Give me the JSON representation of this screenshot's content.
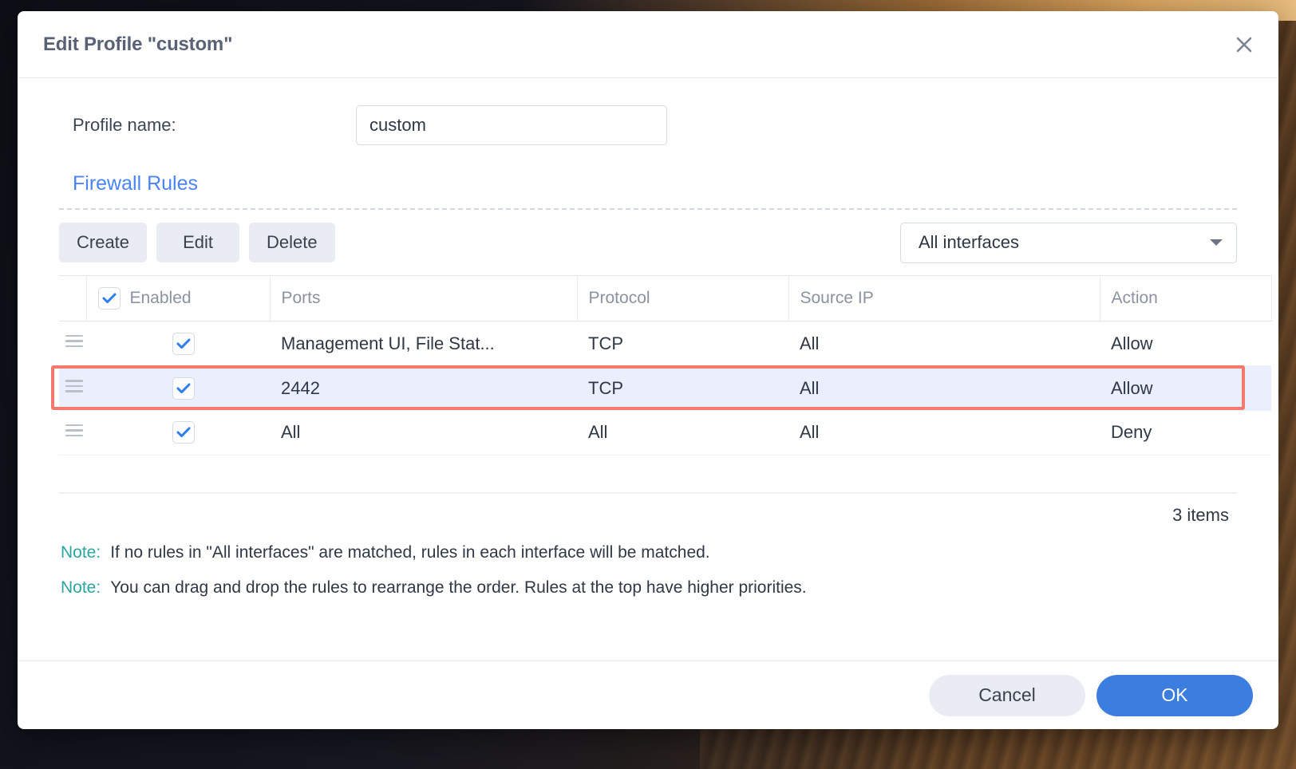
{
  "dialog": {
    "title": "Edit Profile \"custom\"",
    "close_icon": "close-icon"
  },
  "form": {
    "profile_name_label": "Profile name:",
    "profile_name_value": "custom",
    "profile_name_placeholder": "Profile name"
  },
  "section": {
    "title": "Firewall Rules"
  },
  "toolbar": {
    "create_label": "Create",
    "edit_label": "Edit",
    "delete_label": "Delete",
    "interface_selected": "All interfaces",
    "dropdown_icon": "chevron-down-icon"
  },
  "table": {
    "headers": {
      "enabled": "Enabled",
      "ports": "Ports",
      "protocol": "Protocol",
      "source_ip": "Source IP",
      "action": "Action"
    },
    "header_enabled_checked": true,
    "rows": [
      {
        "enabled": true,
        "ports": "Management UI, File Stat...",
        "protocol": "TCP",
        "source_ip": "All",
        "action": "Allow",
        "selected": false
      },
      {
        "enabled": true,
        "ports": "2442",
        "protocol": "TCP",
        "source_ip": "All",
        "action": "Allow",
        "selected": true
      },
      {
        "enabled": true,
        "ports": "All",
        "protocol": "All",
        "source_ip": "All",
        "action": "Deny",
        "selected": false
      }
    ],
    "item_count": "3 items"
  },
  "notes": [
    {
      "label": "Note:",
      "text": "If no rules in \"All interfaces\" are matched, rules in each interface will be matched."
    },
    {
      "label": "Note:",
      "text": "You can drag and drop the rules to rearrange the order. Rules at the top have higher priorities."
    }
  ],
  "footer": {
    "cancel_label": "Cancel",
    "ok_label": "OK"
  },
  "colors": {
    "accent_blue": "#3c7de0",
    "link_blue": "#4a84f5",
    "note_teal": "#2aa5a0",
    "highlight_red": "#f4796d",
    "row_selected_bg": "#eaeffb"
  }
}
